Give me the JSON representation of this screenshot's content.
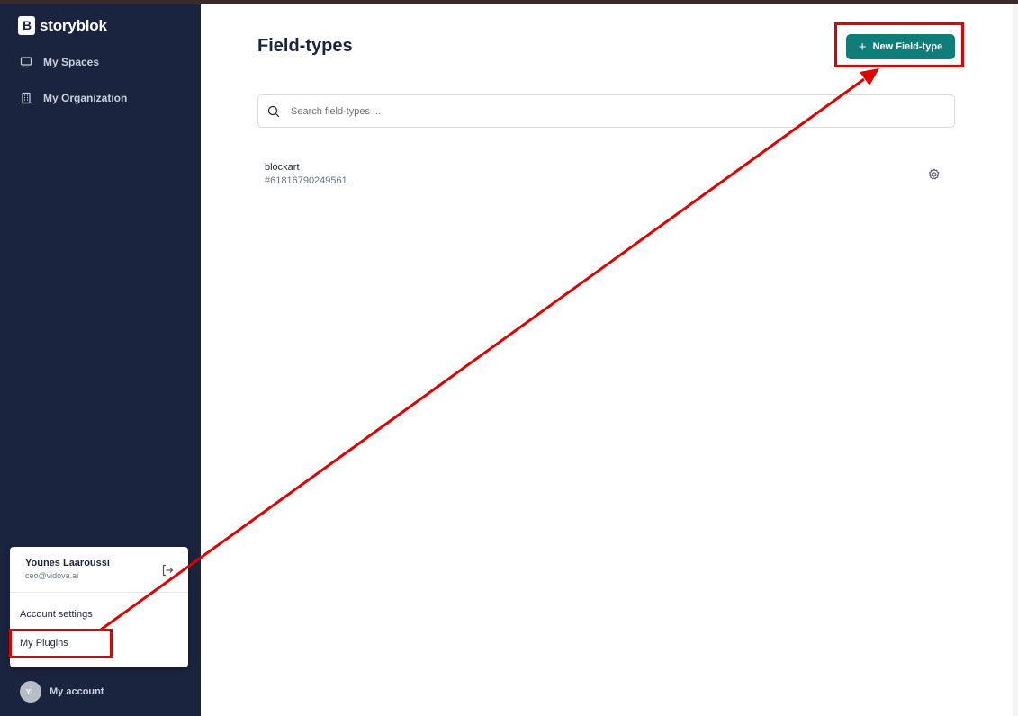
{
  "brand": {
    "name": "storyblok"
  },
  "sidebar": {
    "items": [
      {
        "label": "My Spaces",
        "icon": "monitor-icon"
      },
      {
        "label": "My Organization",
        "icon": "building-icon"
      }
    ]
  },
  "user_menu": {
    "name": "Younes Laaroussi",
    "email": "ceo@vidova.ai",
    "items": [
      "Account settings",
      "My Plugins"
    ]
  },
  "account": {
    "initials": "YL",
    "label": "My account"
  },
  "main": {
    "title": "Field-types",
    "new_button": "New Field-type",
    "search_placeholder": "Search field-types ...",
    "field_types": [
      {
        "name": "blockart",
        "id": "#61816790249561"
      }
    ]
  },
  "colors": {
    "sidebar_bg": "#1b243f",
    "accent": "#0f7e7a",
    "annotation": "#e00000"
  }
}
